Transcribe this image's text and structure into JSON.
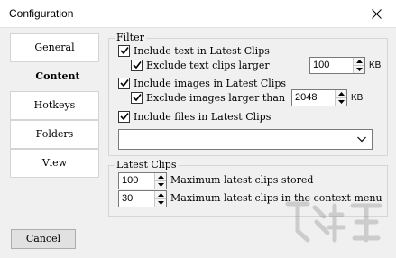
{
  "window": {
    "title": "Configuration"
  },
  "nav": {
    "items": [
      {
        "label": "General",
        "active": false
      },
      {
        "label": "Content",
        "active": true
      },
      {
        "label": "Hotkeys",
        "active": false
      },
      {
        "label": "Folders",
        "active": false
      },
      {
        "label": "View",
        "active": false
      }
    ]
  },
  "filter": {
    "title": "Filter",
    "include_text": {
      "label": "Include text in Latest Clips",
      "checked": true
    },
    "exclude_text": {
      "label": "Exclude text clips larger",
      "checked": true,
      "value": "100",
      "unit": "KB"
    },
    "include_images": {
      "label": "Include images in Latest Clips",
      "checked": true
    },
    "exclude_images": {
      "label": "Exclude images larger than",
      "checked": true,
      "value": "2048",
      "unit": "KB"
    },
    "include_files": {
      "label": "Include files in Latest Clips",
      "checked": true
    },
    "dropdown_value": ""
  },
  "latest": {
    "title": "Latest Clips",
    "max_stored": {
      "value": "100",
      "label": "Maximum latest clips stored"
    },
    "max_context": {
      "value": "30",
      "label": "Maximum latest clips in the context menu"
    }
  },
  "buttons": {
    "cancel": "Cancel"
  }
}
